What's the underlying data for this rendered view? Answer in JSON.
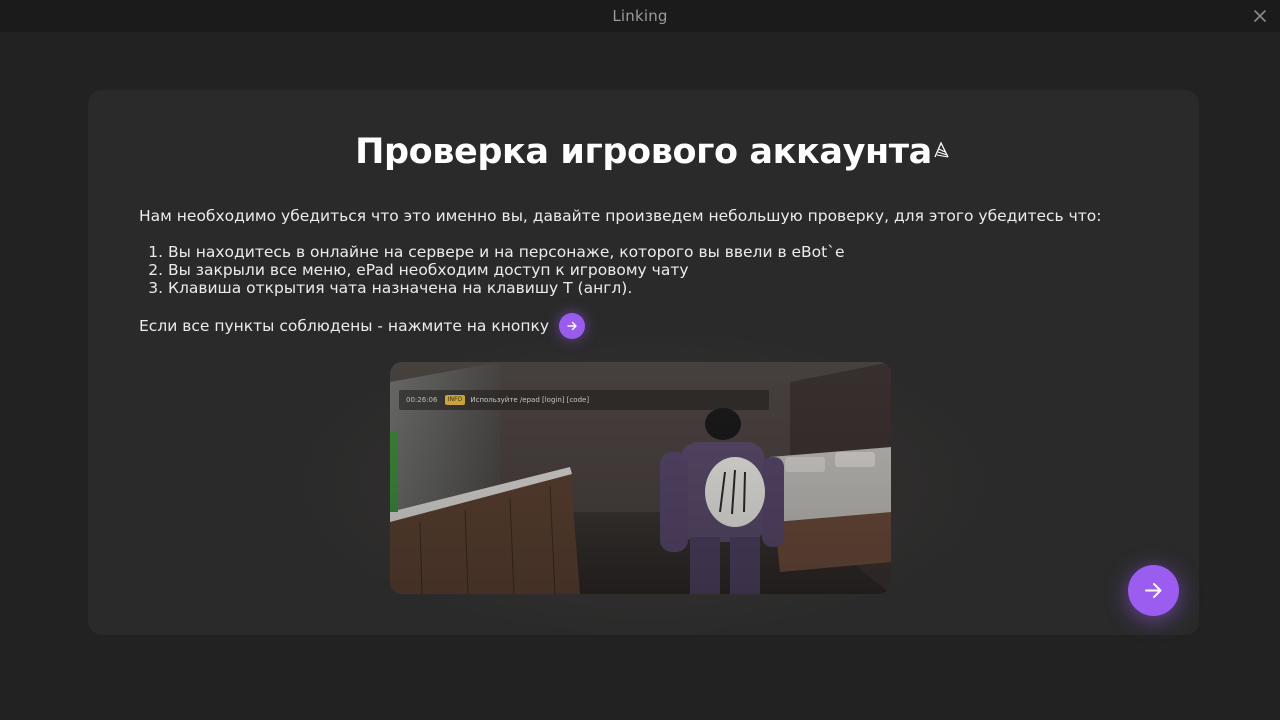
{
  "window": {
    "title": "Linking",
    "close_icon": "close-icon"
  },
  "card": {
    "heading": "Проверка игрового аккаунта",
    "intro": "Нам необходимо убедиться что это именно вы, давайте произведем небольшую проверку, для этого убедитесь что:",
    "steps": [
      {
        "num": "1.",
        "text": "Вы находитесь в онлайне на сервере и на персонаже, которого вы ввели в eBot`e"
      },
      {
        "num": "2.",
        "text": "Вы закрыли все меню, ePad необходим доступ к игровому чату"
      },
      {
        "num": "3.",
        "text": "Клавиша открытия чата назначена на клавишу Т (англ)."
      }
    ],
    "confirm_text": "Если все пункты соблюдены - нажмите на кнопку",
    "preview": {
      "chat_time": "00:26:06",
      "chat_tag": "INFO",
      "chat_text": "Используйте /epad [login] [code]"
    }
  },
  "colors": {
    "background": "#222222",
    "card": "#2a2a2a",
    "accent": "#9b5cf0"
  },
  "icons": {
    "next_button": "arrow-right-icon",
    "inline_button": "arrow-right-icon",
    "brand_logo": "brand-logo-icon"
  }
}
